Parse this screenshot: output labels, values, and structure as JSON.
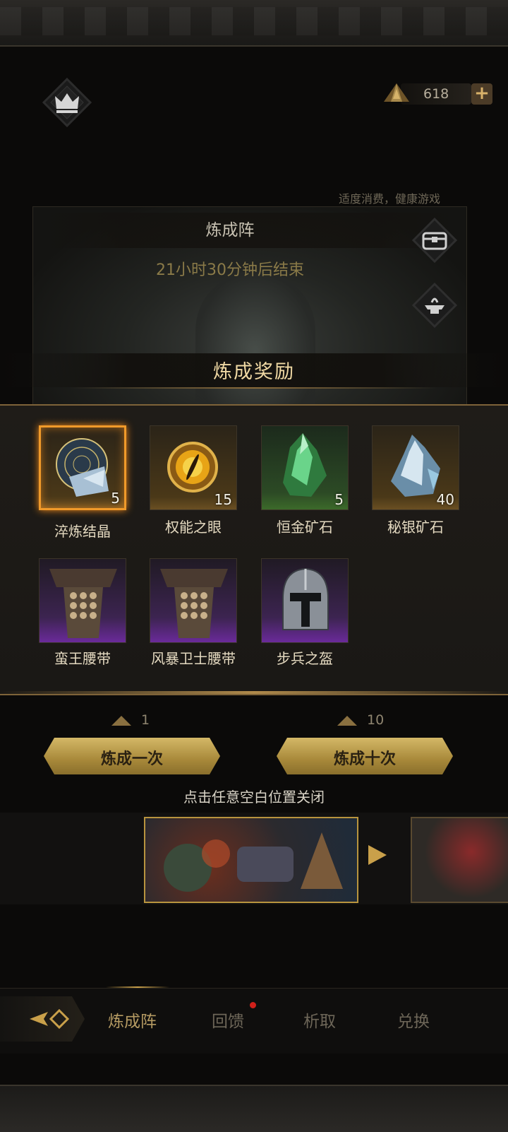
{
  "header": {
    "currency_value": "618",
    "currency_add": "+"
  },
  "notice": "适度消费，健康游戏",
  "banner": {
    "title": "炼成阵",
    "timer": "21小时30分钟后结束"
  },
  "reward_popup": {
    "title": "炼成奖励",
    "items": [
      {
        "name": "淬炼结晶",
        "count": "5",
        "rarity": "legendary"
      },
      {
        "name": "权能之眼",
        "count": "15",
        "rarity": "gold"
      },
      {
        "name": "恒金矿石",
        "count": "5",
        "rarity": "green"
      },
      {
        "name": "秘银矿石",
        "count": "40",
        "rarity": "gold"
      },
      {
        "name": "蛮王腰带",
        "count": "",
        "rarity": "purple"
      },
      {
        "name": "风暴卫士腰带",
        "count": "",
        "rarity": "purple"
      },
      {
        "name": "步兵之盔",
        "count": "",
        "rarity": "purple"
      }
    ]
  },
  "forge": {
    "once": {
      "cost": "1",
      "label": "炼成一次"
    },
    "ten": {
      "cost": "10",
      "label": "炼成十次"
    }
  },
  "close_hint": "点击任意空白位置关闭",
  "nav": {
    "tabs": [
      "炼成阵",
      "回馈",
      "析取",
      "兑换"
    ],
    "active_tab": "炼成阵"
  },
  "colors": {
    "accent_gold": "#c9a04a",
    "legendary_border": "#f09a2a",
    "purple_rarity": "#6a2a9a",
    "notification": "#d0201a"
  }
}
